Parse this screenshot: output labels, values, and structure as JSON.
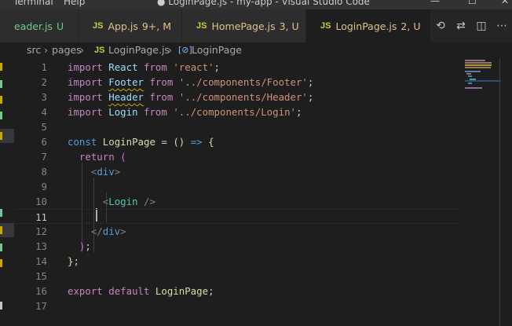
{
  "titlebar": {
    "menu": [
      "Terminal",
      "Help"
    ],
    "title": "● LoginPage.js - my-app - Visual Studio Code",
    "window_controls": [
      "—",
      "☐",
      "✕"
    ]
  },
  "tabs": [
    {
      "icon": "JS",
      "name": "eader.js",
      "status": "U",
      "status_color": "#73c991",
      "name_color": "#73c991"
    },
    {
      "icon": "JS",
      "name": "App.js",
      "status": "9+, M",
      "status_color": "#e2c08d",
      "name_color": "#e2c08d"
    },
    {
      "icon": "JS",
      "name": "HomePage.js",
      "status": "3, U",
      "status_color": "#e2c08d",
      "name_color": "#e2c08d"
    },
    {
      "icon": "JS",
      "name": "LoginPage.js",
      "status": "2, U",
      "status_color": "#e2c08d",
      "name_color": "#e2c08d",
      "active": true,
      "dirty": true
    }
  ],
  "editor_actions": [
    "timeline-icon",
    "compare-changes-icon",
    "split-editor-icon",
    "more-actions-icon"
  ],
  "breadcrumb": {
    "parts": [
      "src",
      "pages",
      "LoginPage.js",
      "LoginPage"
    ],
    "file_icon": "JS",
    "symbol_icon": "[⊘]"
  },
  "editor": {
    "current_line": 11,
    "lines": [
      {
        "n": "1",
        "tokens": [
          [
            "kw",
            "import"
          ],
          [
            "",
            " "
          ],
          [
            "id",
            "React"
          ],
          [
            "",
            " "
          ],
          [
            "kw",
            "from"
          ],
          [
            "",
            " "
          ],
          [
            "str",
            "'react'"
          ],
          [
            "",
            ";"
          ]
        ]
      },
      {
        "n": "2",
        "tokens": [
          [
            "kw",
            "import"
          ],
          [
            "",
            " "
          ],
          [
            "id squig",
            "Footer"
          ],
          [
            "",
            " "
          ],
          [
            "kw",
            "from"
          ],
          [
            "",
            " "
          ],
          [
            "str",
            "'../components/Footer'"
          ],
          [
            "",
            ";"
          ]
        ]
      },
      {
        "n": "3",
        "tokens": [
          [
            "kw",
            "import"
          ],
          [
            "",
            " "
          ],
          [
            "id squig",
            "Header"
          ],
          [
            "",
            " "
          ],
          [
            "kw",
            "from"
          ],
          [
            "",
            " "
          ],
          [
            "str",
            "'../components/Header'"
          ],
          [
            "",
            ";"
          ]
        ]
      },
      {
        "n": "4",
        "tokens": [
          [
            "kw",
            "import"
          ],
          [
            "",
            " "
          ],
          [
            "id",
            "Login"
          ],
          [
            "",
            " "
          ],
          [
            "kw",
            "from"
          ],
          [
            "",
            " "
          ],
          [
            "str",
            "'../components/Login'"
          ],
          [
            "",
            ";"
          ]
        ]
      },
      {
        "n": "5",
        "tokens": []
      },
      {
        "n": "6",
        "tokens": [
          [
            "blue",
            "const"
          ],
          [
            "",
            " "
          ],
          [
            "fn",
            "LoginPage"
          ],
          [
            "",
            " = "
          ],
          [
            "fn",
            "()"
          ],
          [
            "",
            " "
          ],
          [
            "blue",
            "=>"
          ],
          [
            "",
            " "
          ],
          [
            "fn",
            "{"
          ]
        ]
      },
      {
        "n": "7",
        "tokens": [
          [
            "",
            "  "
          ],
          [
            "kw",
            "return"
          ],
          [
            "",
            " "
          ],
          [
            "par",
            "("
          ]
        ]
      },
      {
        "n": "8",
        "tokens": [
          [
            "",
            "    "
          ],
          [
            "br",
            "<"
          ],
          [
            "blue",
            "div"
          ],
          [
            "br",
            ">"
          ]
        ]
      },
      {
        "n": "9",
        "tokens": []
      },
      {
        "n": "10",
        "tokens": [
          [
            "",
            "      "
          ],
          [
            "br",
            "<"
          ],
          [
            "tag",
            "Login"
          ],
          [
            "",
            " "
          ],
          [
            "br",
            "/>"
          ]
        ]
      },
      {
        "n": "11",
        "tokens": []
      },
      {
        "n": "12",
        "tokens": [
          [
            "",
            "    "
          ],
          [
            "br",
            "</"
          ],
          [
            "blue",
            "div"
          ],
          [
            "br",
            ">"
          ]
        ]
      },
      {
        "n": "13",
        "tokens": [
          [
            "",
            "  "
          ],
          [
            "par",
            ")"
          ],
          [
            "",
            ";"
          ]
        ]
      },
      {
        "n": "14",
        "tokens": [
          [
            "fn",
            "}"
          ],
          [
            "",
            ";"
          ]
        ]
      },
      {
        "n": "15",
        "tokens": []
      },
      {
        "n": "16",
        "tokens": [
          [
            "kw",
            "export"
          ],
          [
            "",
            " "
          ],
          [
            "kw",
            "default"
          ],
          [
            "",
            " "
          ],
          [
            "fn",
            "LoginPage"
          ],
          [
            "",
            ";"
          ]
        ]
      },
      {
        "n": "17",
        "tokens": []
      }
    ]
  },
  "colors": {
    "editor_bg": "#1e1e1e",
    "tab_inactive": "#2d2d2d",
    "modified": "#e2c08d",
    "untracked": "#73c991",
    "js_icon": "#cbcb41"
  }
}
